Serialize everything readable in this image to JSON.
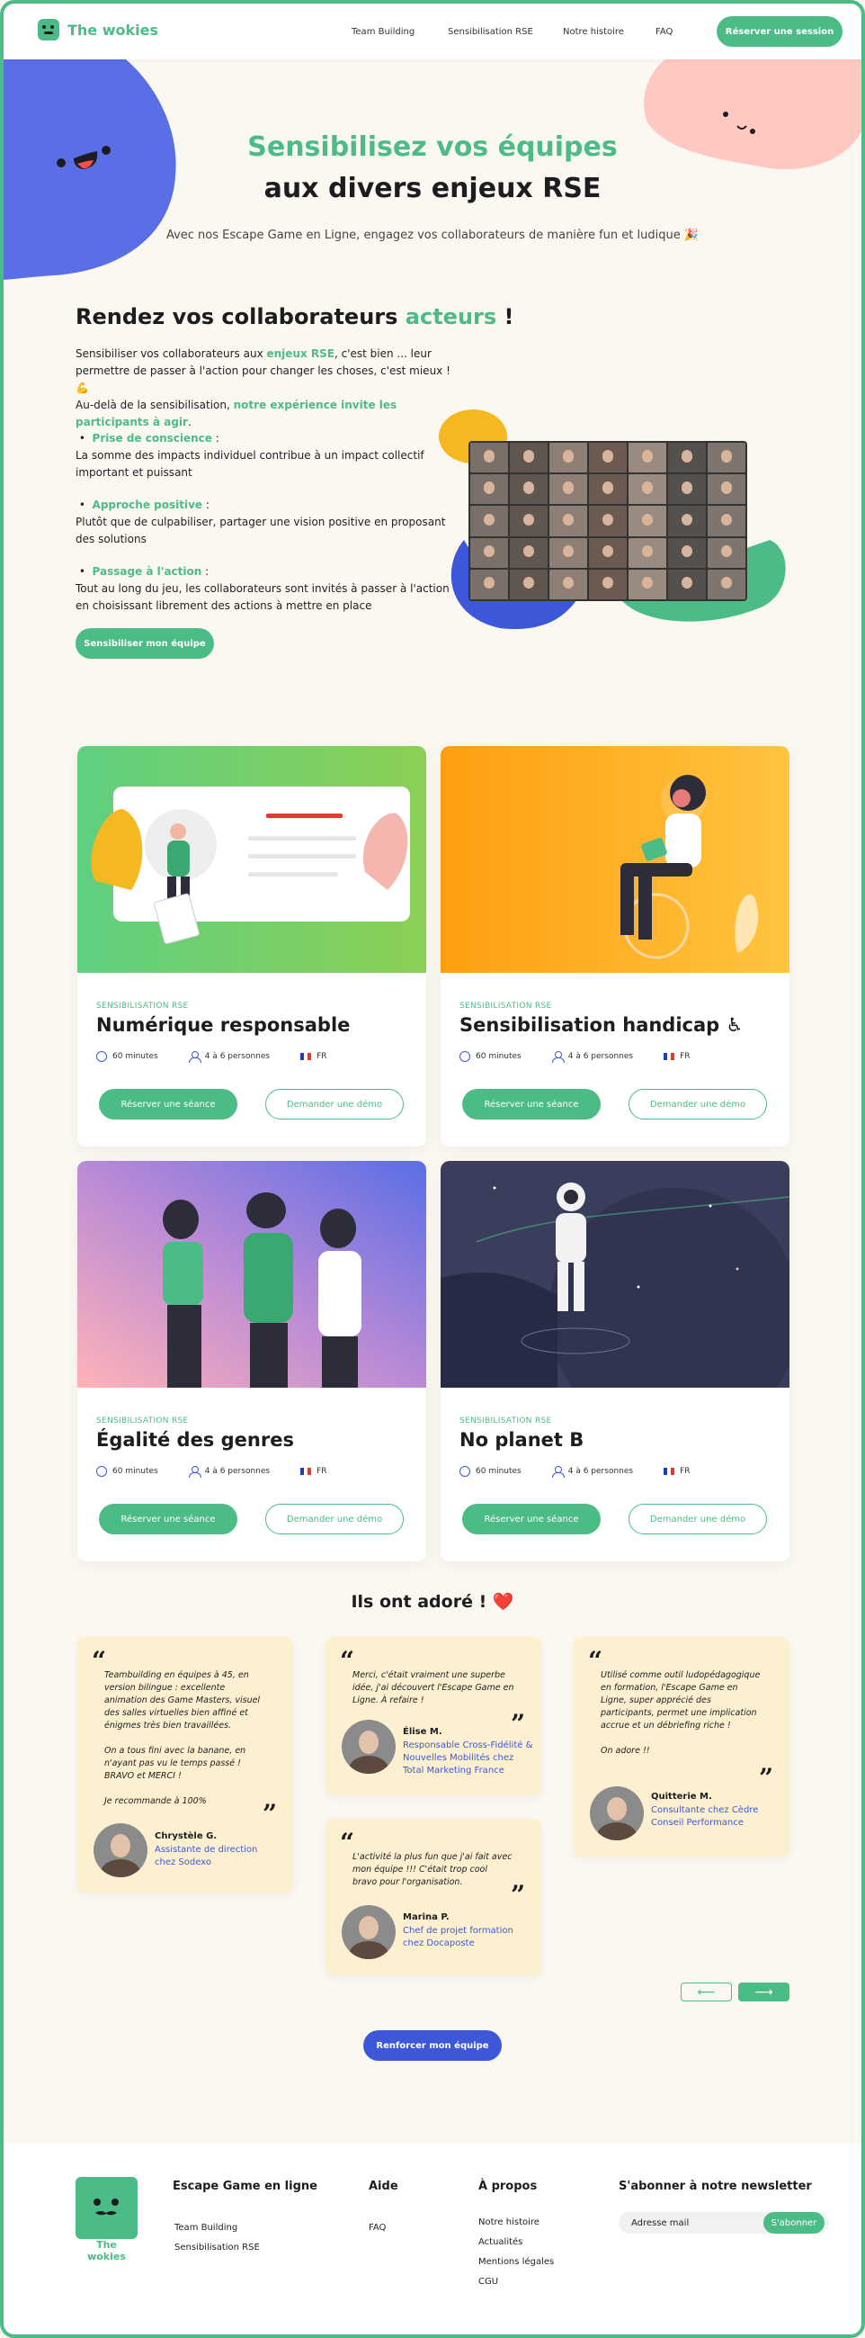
{
  "nav": {
    "brand": "The wokies",
    "links": [
      "Team Building",
      "Sensibilisation RSE",
      "Notre histoire",
      "FAQ"
    ],
    "cta": "Réserver une session"
  },
  "hero": {
    "title_accent": "Sensibilisez vos équipes",
    "title_rest": "aux divers enjeux RSE",
    "subtitle": "Avec nos Escape Game en Ligne, engagez vos collaborateurs de manière fun et ludique 🎉"
  },
  "intro": {
    "title_start": "Rendez vos collaborateurs ",
    "title_accent": "acteurs",
    "title_end": " !",
    "p1_a": "Sensibiliser vos collaborateurs aux ",
    "p1_b": "enjeux RSE",
    "p1_c": ", c'est bien ... leur permettre de passer à l'action pour changer les choses, c'est mieux ! 💪",
    "p2_a": "Au-delà de la sensibilisation, ",
    "p2_b": "notre expérience invite les participants à agir",
    "p2_c": ".",
    "bullets": [
      {
        "title": "Prise de conscience",
        "text": "La somme des impacts individuel contribue à un impact collectif important et puissant"
      },
      {
        "title": "Approche positive",
        "text": "Plutôt que de culpabiliser, partager une vision positive en proposant des solutions"
      },
      {
        "title": "Passage à l'action",
        "text": "Tout au long du jeu, les collaborateurs sont invités à passer à l'action en choisissant librement des actions à mettre en place"
      }
    ],
    "button": "Sensibiliser mon équipe"
  },
  "cards": [
    {
      "tag": "SENSIBILISATION RSE",
      "title": "Numérique responsable",
      "duration": "60 minutes",
      "people": "4 à 6 personnes",
      "lang": "FR",
      "book": "Réserver une séance",
      "demo": "Demander une démo"
    },
    {
      "tag": "SENSIBILISATION RSE",
      "title": "Sensibilisation handicap ♿",
      "duration": "60 minutes",
      "people": "4 à 6 personnes",
      "lang": "FR",
      "book": "Réserver une séance",
      "demo": "Demander une démo"
    },
    {
      "tag": "SENSIBILISATION RSE",
      "title": "Égalité des genres",
      "duration": "60 minutes",
      "people": "4 à 6 personnes",
      "lang": "FR",
      "book": "Réserver une séance",
      "demo": "Demander une démo"
    },
    {
      "tag": "SENSIBILISATION RSE",
      "title": "No planet B",
      "duration": "60 minutes",
      "people": "4 à 6 personnes",
      "lang": "FR",
      "book": "Réserver une séance",
      "demo": "Demander une démo"
    }
  ],
  "testimonials": {
    "title": "Ils ont adoré ! ❤️",
    "items": [
      {
        "text": "Teambuilding en équipes à 45, en version bilingue : excellente animation des Game Masters, visuel des salles virtuelles bien affiné et énigmes très bien travaillées.\n\nOn a tous fini avec la banane, en n'ayant pas vu le temps passé ! BRAVO et MERCI !\n\nJe recommande à 100%",
        "name": "Chrystèle G.",
        "role": "Assistante de direction chez Sodexo"
      },
      {
        "text": "Merci, c'était vraiment une superbe idée, j'ai découvert l'Escape Game en Ligne. À refaire !",
        "name": "Élise M.",
        "role": "Responsable Cross-Fidélité & Nouvelles Mobilités chez Total Marketing France"
      },
      {
        "text": "L'activité la plus fun que j'ai fait avec mon équipe !!! C'était trop cool bravo pour l'organisation.",
        "name": "Marina P.",
        "role": "Chef de projet formation chez Docaposte"
      },
      {
        "text": "Utilisé comme outil ludopédagogique en formation, l'Escape Game en Ligne, super apprécié des participants, permet une implication accrue et un débriefing riche !\n\nOn adore !!",
        "name": "Quitterie M.",
        "role": "Consultante chez Cèdre Conseil Performance"
      }
    ],
    "prev": "⟵",
    "next": "⟶",
    "cta": "Renforcer  mon équipe"
  },
  "footer": {
    "brand": "The wokies",
    "col1_title": "Escape Game en ligne",
    "col1_links": [
      "Team Building",
      "Sensibilisation RSE"
    ],
    "col2_title": "Aide",
    "col2_links": [
      "FAQ"
    ],
    "col3_title": "À propos",
    "col3_links": [
      "Notre histoire",
      "Actualités",
      "Mentions légales",
      "CGU"
    ],
    "news_title": "S'abonner à notre newsletter",
    "news_placeholder": "Adresse mail",
    "news_button": "S'abonner"
  },
  "colors": {
    "green": "#4cbc86",
    "blue": "#3c57d8",
    "pink": "#ffc9c2",
    "cream": "#fdf0d0"
  }
}
